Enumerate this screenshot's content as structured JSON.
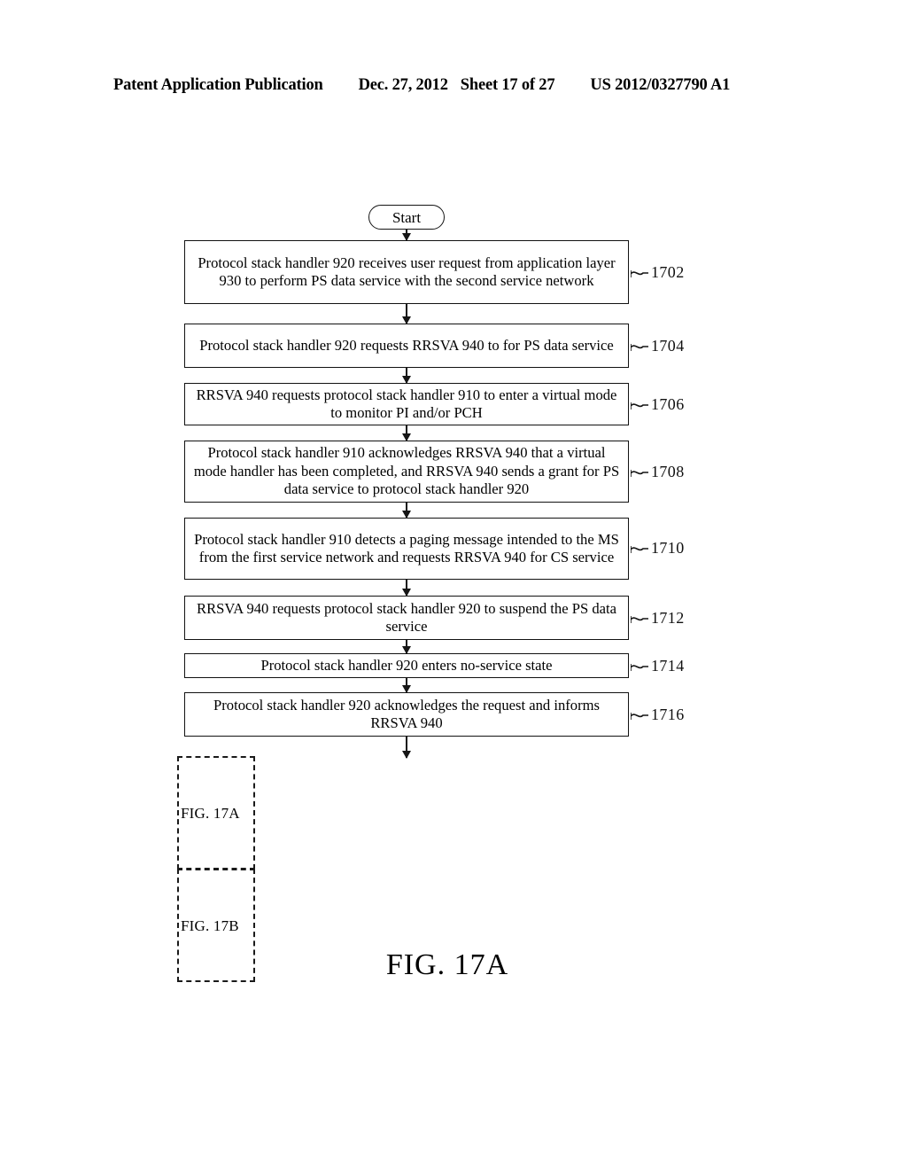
{
  "header": {
    "publication": "Patent Application Publication",
    "date": "Dec. 27, 2012",
    "sheet": "Sheet 17 of 27",
    "patent_number": "US 2012/0327790 A1"
  },
  "figure": {
    "caption": "FIG.  17A",
    "start_label": "Start",
    "steps": [
      {
        "ref": "1702",
        "text": "Protocol stack handler 920 receives user request from application layer 930 to perform PS data service with the second service network"
      },
      {
        "ref": "1704",
        "text": "Protocol stack handler 920 requests RRSVA 940 to for PS data service"
      },
      {
        "ref": "1706",
        "text": "RRSVA 940 requests protocol stack handler 910 to enter a virtual mode to monitor PI and/or PCH"
      },
      {
        "ref": "1708",
        "text": "Protocol stack handler 910 acknowledges RRSVA 940 that a virtual mode handler has been completed, and RRSVA 940 sends a grant for PS data service to protocol stack handler 920"
      },
      {
        "ref": "1710",
        "text": "Protocol stack handler 910 detects a paging message intended to the MS from the first service network and requests RRSVA 940 for CS service"
      },
      {
        "ref": "1712",
        "text": "RRSVA 940 requests protocol stack handler 920 to suspend the PS data service"
      },
      {
        "ref": "1714",
        "text": "Protocol stack handler 920 enters no-service state"
      },
      {
        "ref": "1716",
        "text": "Protocol stack handler 920 acknowledges the request and informs RRSVA 940"
      }
    ]
  },
  "legend": {
    "cells": [
      {
        "label": "FIG. 17A"
      },
      {
        "label": "FIG. 17B"
      }
    ]
  },
  "colors": {
    "ink": "#111111",
    "paper": "#ffffff"
  }
}
